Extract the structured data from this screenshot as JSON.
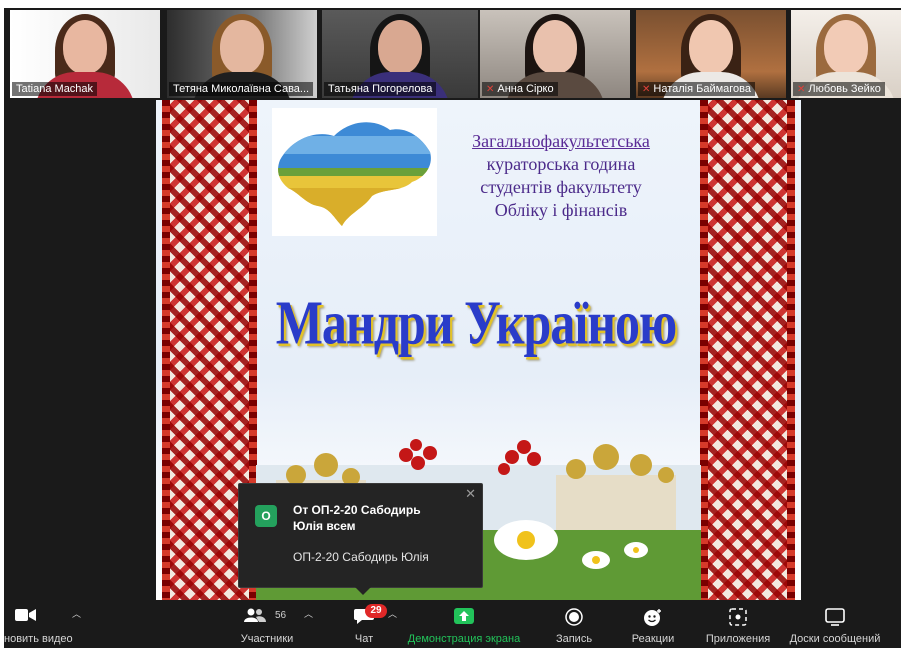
{
  "participants": [
    {
      "name": "Tatiana Machak",
      "muted": false
    },
    {
      "name": "Тетяна Миколаївна Сава...",
      "muted": false
    },
    {
      "name": "Татьяна Погорелова",
      "muted": false,
      "active_speaker": true
    },
    {
      "name": "Анна Сірко",
      "muted": true
    },
    {
      "name": "Наталія Баймагова",
      "muted": true
    },
    {
      "name": "Любовь Зейко",
      "muted": true
    }
  ],
  "slide": {
    "subtitle_lines": [
      "Загальнофакультетська",
      "кураторська година",
      "студентів факультету",
      "Обліку і фінансів"
    ],
    "title": "Мандри Україною"
  },
  "chat_notification": {
    "avatar_letter": "О",
    "from": "От ОП-2-20 Сабодирь Юлія всем",
    "message": "ОП-2-20 Сабодирь Юлія"
  },
  "toolbar": {
    "video_label": "новить видео",
    "participants_label": "Участники",
    "participants_count": "56",
    "chat_label": "Чат",
    "chat_badge": "29",
    "share_label": "Демонстрация экрана",
    "record_label": "Запись",
    "reactions_label": "Реакции",
    "apps_label": "Приложения",
    "whiteboard_label": "Доски сообщений"
  },
  "colors": {
    "toolbar_bg": "#1a1a1a",
    "share_green": "#22c35a",
    "chat_badge_red": "#e02828",
    "active_speaker_border": "#b7c63f",
    "title_blue": "#2a3cc9",
    "subtitle_purple": "#4b2a8a"
  }
}
